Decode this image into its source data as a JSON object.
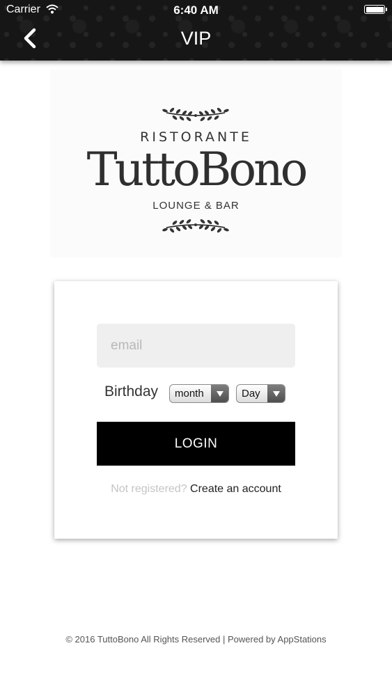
{
  "status_bar": {
    "carrier": "Carrier",
    "time": "6:40 AM",
    "battery_level": 1.0
  },
  "nav": {
    "title": "VIP",
    "back_icon": "chevron-left-icon"
  },
  "logo": {
    "line1": "RISTORANTE",
    "name": "TuttoBono",
    "line3": "LOUNGE & BAR"
  },
  "form": {
    "email_placeholder": "email",
    "birthday_label": "Birthday",
    "month_selected": "month",
    "day_selected": "Day",
    "login_label": "LOGIN",
    "not_registered": "Not registered?",
    "create_account": "Create an account"
  },
  "footer": {
    "text": "© 2016 TuttoBono All Rights Reserved | Powered by AppStations"
  },
  "colors": {
    "header_bg": "#161616",
    "button_bg": "#000000",
    "input_bg": "#efeff0"
  }
}
